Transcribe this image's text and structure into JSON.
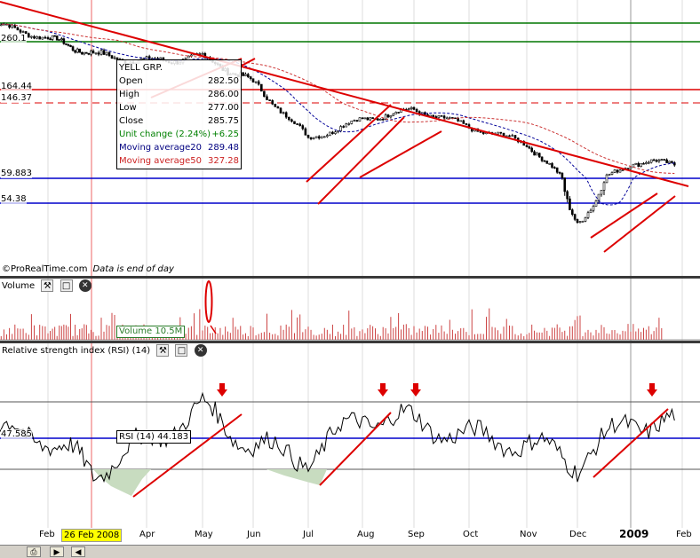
{
  "panels": {
    "volume_title": "Volume",
    "rsi_title": "Relative strength index (RSI) (14)"
  },
  "credit": {
    "source": "©ProRealTime.com",
    "note": "Data is end of day"
  },
  "tooltip": {
    "name": "YELL GRP.",
    "rows": [
      {
        "label": "Open",
        "value": "282.50",
        "color": "#000000"
      },
      {
        "label": "High",
        "value": "286.00",
        "color": "#000000"
      },
      {
        "label": "Low",
        "value": "277.00",
        "color": "#000000"
      },
      {
        "label": "Close",
        "value": "285.75",
        "color": "#000000"
      },
      {
        "label": "Unit change (2.24%)",
        "value": "+6.25",
        "color": "#008000"
      },
      {
        "label": "Moving average20",
        "value": "289.48",
        "color": "#000080"
      },
      {
        "label": "Moving average50",
        "value": "327.28",
        "color": "#cc2222"
      }
    ]
  },
  "levels": [
    "260.1",
    "164.44",
    "146.37",
    "59.883",
    "54.38"
  ],
  "volume_label": "Volume 10.5M",
  "rsi_label": "RSI (14) 44.183",
  "rsi_level": "47.585",
  "date_highlight": "26 Feb 2008",
  "months": [
    "Feb",
    "Apr",
    "May",
    "Jun",
    "Jul",
    "Aug",
    "Sep",
    "Oct",
    "Nov",
    "Dec",
    "2009",
    "Feb"
  ],
  "colors": {
    "trend": "#dd0000",
    "support_green": "#007700",
    "support_blue": "#0000cc",
    "ma20": "#000099",
    "ma50": "#cc3333",
    "volume": "#cc4444",
    "arrow": "#dd0000"
  },
  "chart_data": {
    "type": "candlestick",
    "security": "YELL GRP.",
    "x": [
      "2008-01",
      "2008-02",
      "2008-03",
      "2008-04",
      "2008-05",
      "2008-06",
      "2008-07",
      "2008-08",
      "2008-09",
      "2008-10",
      "2008-11",
      "2008-12",
      "2009-01",
      "2009-02"
    ],
    "price_levels": [
      260.1,
      164.44,
      146.37,
      59.883,
      54.38
    ],
    "price_close_approx": [
      320,
      270,
      230,
      215,
      225,
      175,
      95,
      120,
      135,
      110,
      90,
      45,
      72,
      72
    ],
    "rsi_period": 14,
    "rsi_approx": [
      55,
      52,
      36,
      50,
      66,
      48,
      42,
      62,
      60,
      52,
      50,
      40,
      60,
      58
    ],
    "rsi_current": 44.183,
    "rsi_level": 47.585,
    "volume_last": "10.5M"
  }
}
